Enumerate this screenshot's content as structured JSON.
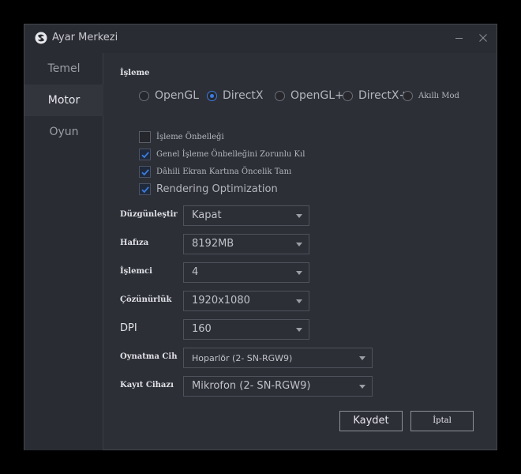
{
  "window": {
    "title": "Ayar Merkezi"
  },
  "sidebar": {
    "items": [
      {
        "label": "Temel"
      },
      {
        "label": "Motor"
      },
      {
        "label": "Oyun"
      }
    ],
    "active": "Motor"
  },
  "rendering": {
    "section_label": "İşleme",
    "options": [
      {
        "label": "OpenGL",
        "checked": false
      },
      {
        "label": "DirectX",
        "checked": true
      },
      {
        "label": "OpenGL+",
        "checked": false
      },
      {
        "label": "DirectX+",
        "checked": false
      },
      {
        "label": "Akıllı Mod",
        "checked": false
      }
    ],
    "checkboxes": [
      {
        "label": "İşleme Önbelleği",
        "checked": false
      },
      {
        "label": "Genel İşleme Önbelleğini Zorunlu Kıl",
        "checked": true
      },
      {
        "label": "Dâhili Ekran Kartına Öncelik Tanı",
        "checked": true
      },
      {
        "label": "Rendering Optimization",
        "checked": true
      }
    ]
  },
  "fields": [
    {
      "label": "Düzgünleştir",
      "value": "Kapat"
    },
    {
      "label": "Hafıza",
      "value": "8192MB"
    },
    {
      "label": "İşlemci",
      "value": "4"
    },
    {
      "label": "Çözünürlük",
      "value": "1920x1080"
    },
    {
      "label": "DPI",
      "value": "160"
    },
    {
      "label": "Oynatma Cih",
      "value": "Hoparlör (2- SN-RGW9)"
    },
    {
      "label": "Kayıt Cihazı",
      "value": "Mikrofon (2- SN-RGW9)"
    }
  ],
  "buttons": {
    "save": "Kaydet",
    "cancel": "İptal"
  },
  "colors": {
    "accent": "#3a7de0",
    "background": "#2d2f37",
    "sidebar": "#2a2c33"
  },
  "icons": {
    "app": "app-logo-icon",
    "minimize": "minimize-icon",
    "close": "close-icon",
    "check": "checkmark-icon",
    "dropdown": "chevron-down-icon"
  }
}
